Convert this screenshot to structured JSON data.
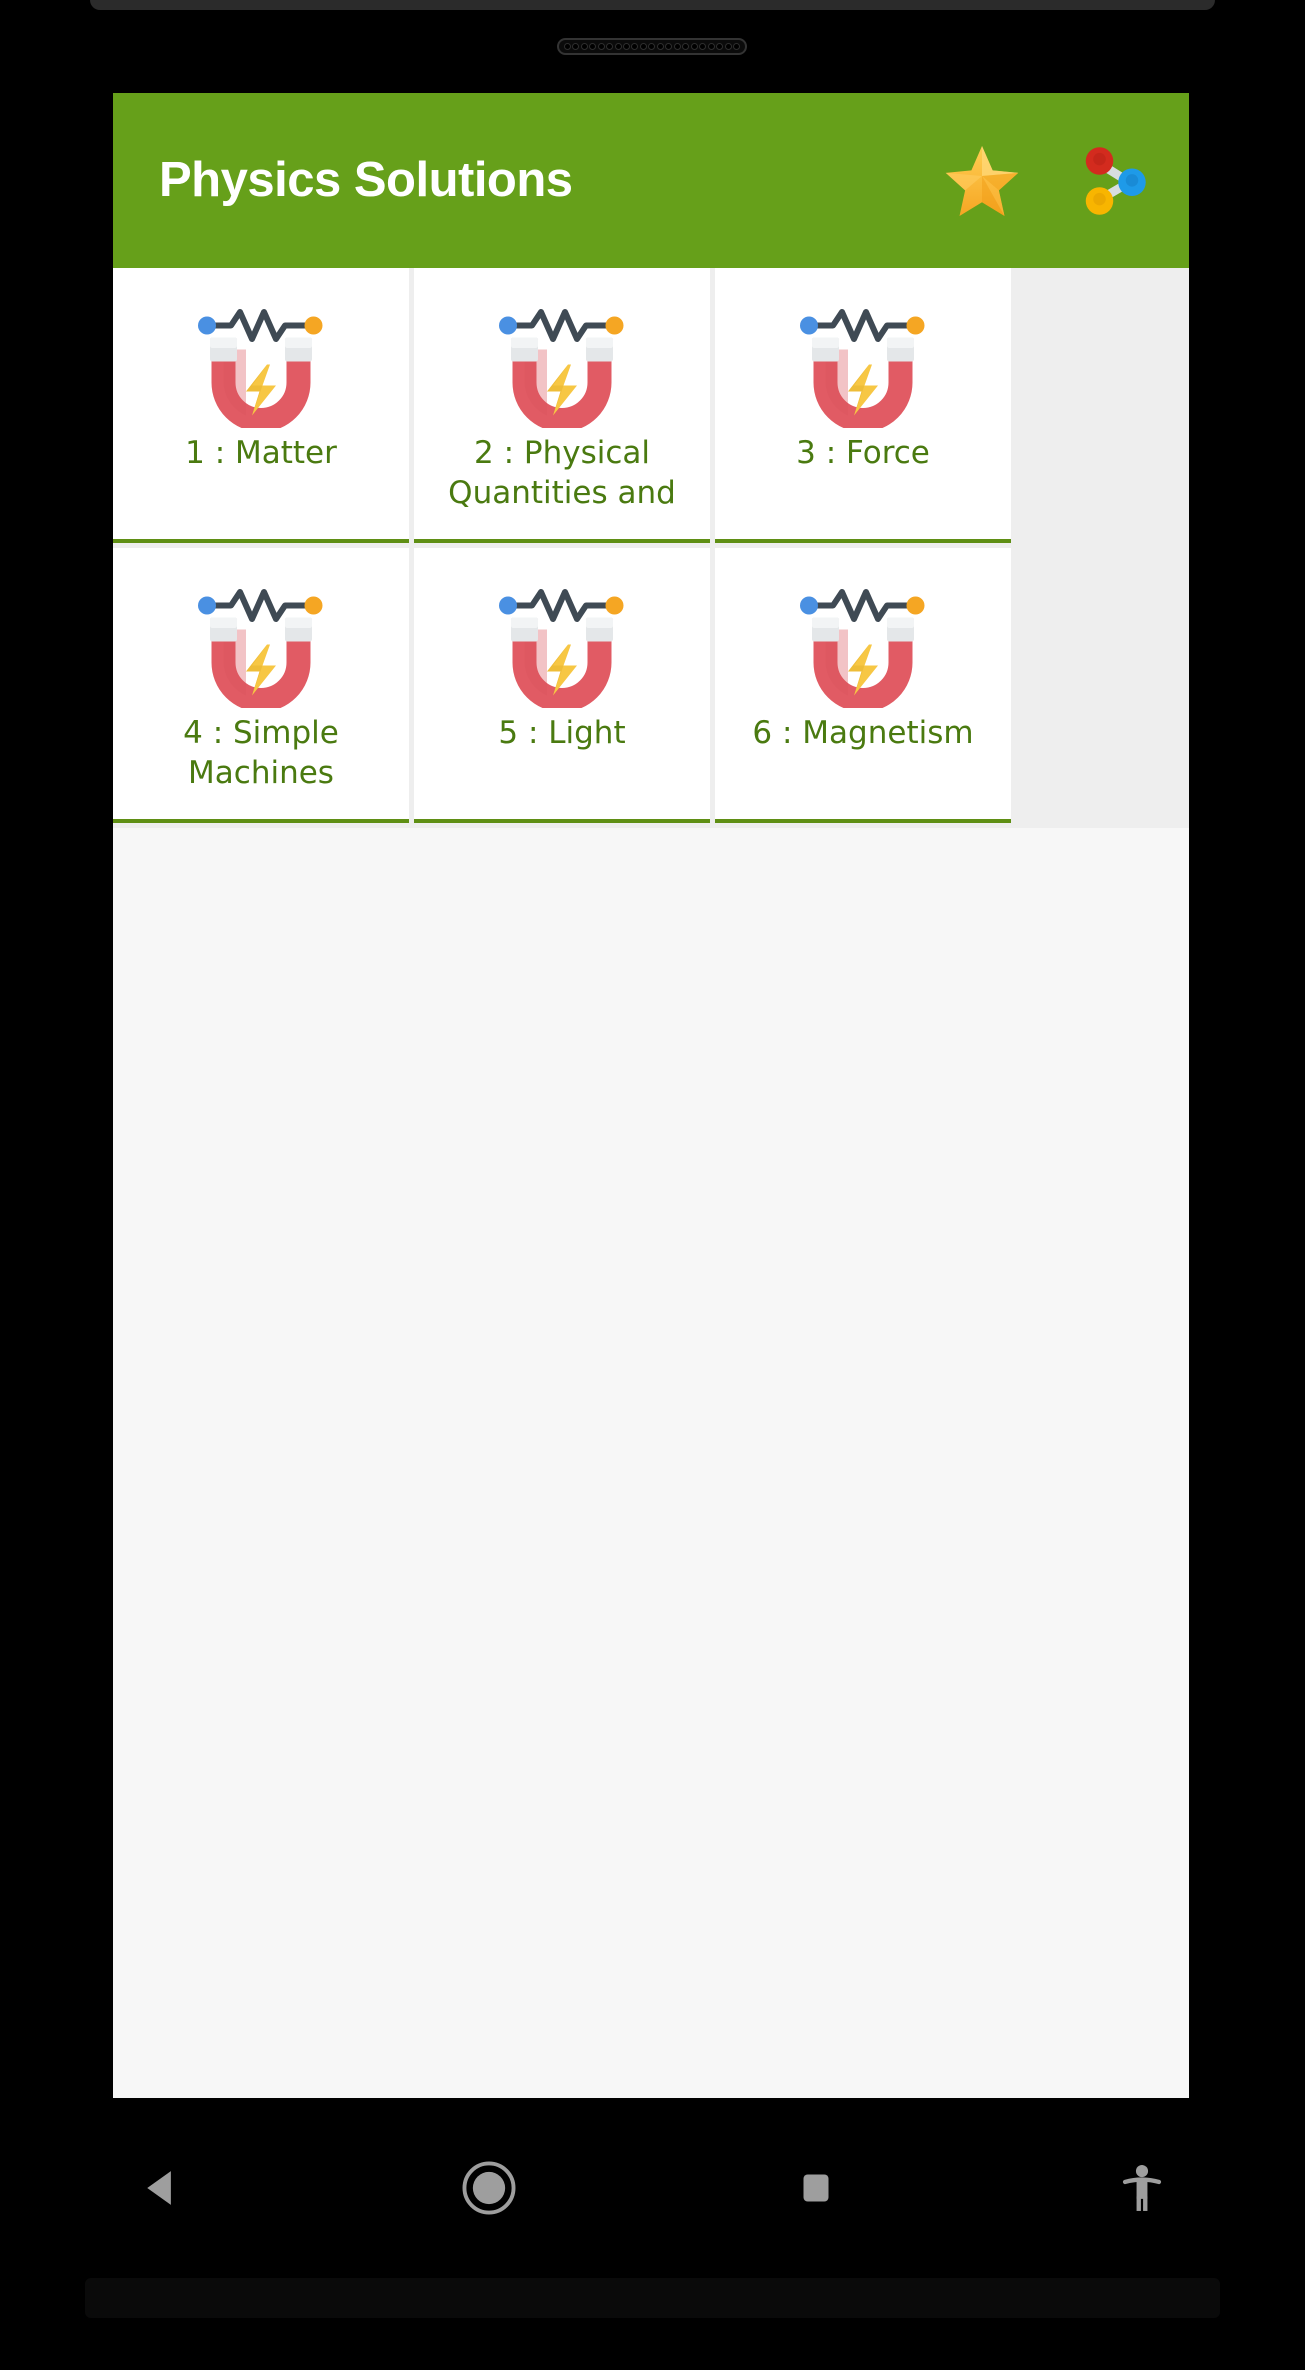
{
  "device": {
    "speaker_icon": "speaker-grille-icon",
    "hole_count": 21
  },
  "appbar": {
    "title": "Physics Solutions",
    "background_color": "#66a01a",
    "title_color": "#ffffff",
    "actions": [
      {
        "name": "favorite-star-icon",
        "label": "star"
      },
      {
        "name": "share-icon",
        "label": "share"
      }
    ]
  },
  "grid": {
    "card_background": "#ffffff",
    "card_border_color": "#5f8f14",
    "label_color": "#4a7a10",
    "icon_name": "magnet-electricity-icon",
    "cards": [
      {
        "label": "1 : Matter"
      },
      {
        "label": "2 : Physical Quantities and"
      },
      {
        "label": "3 : Force"
      },
      {
        "label": "4 : Simple Machines"
      },
      {
        "label": "5 : Light"
      },
      {
        "label": "6 : Magnetism"
      }
    ]
  },
  "navbar": {
    "background_color": "#000000",
    "icon_color": "#9e9e9e",
    "buttons": [
      {
        "name": "nav-back-button",
        "label": "Back"
      },
      {
        "name": "nav-home-button",
        "label": "Home"
      },
      {
        "name": "nav-recents-button",
        "label": "Recents"
      },
      {
        "name": "nav-accessibility-button",
        "label": "Accessibility"
      }
    ]
  }
}
